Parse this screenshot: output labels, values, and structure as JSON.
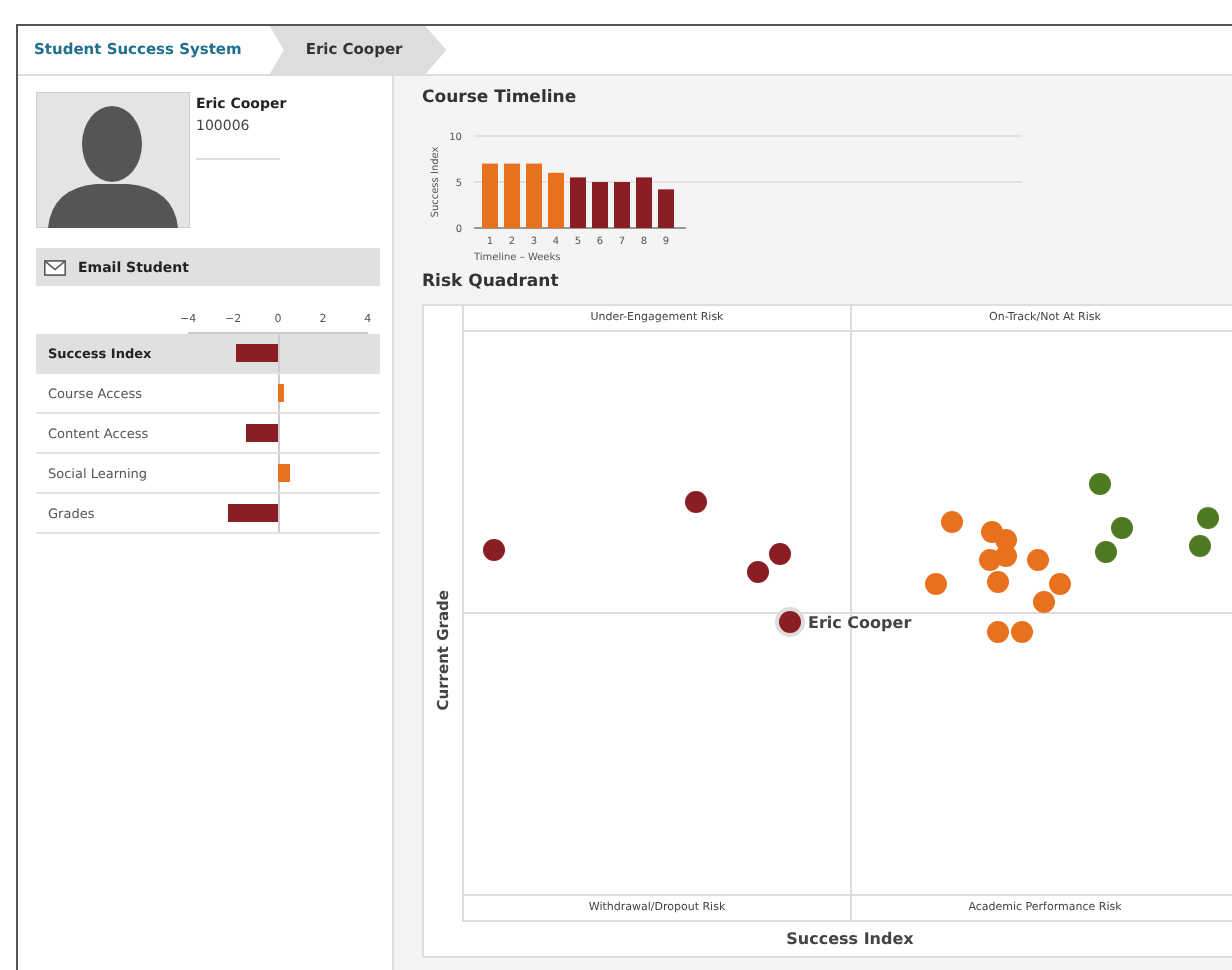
{
  "breadcrumbs": [
    {
      "label": "Student Success System",
      "selected": false
    },
    {
      "label": "Eric Cooper",
      "selected": true
    }
  ],
  "student": {
    "name": "Eric Cooper",
    "id": "100006"
  },
  "email_button": "Email Student",
  "factors": {
    "rows": [
      {
        "selected": true
      },
      {
        "selected": false
      },
      {
        "selected": false
      },
      {
        "selected": false
      },
      {
        "selected": false
      }
    ],
    "chart_data": {
      "type": "bar",
      "orientation": "horizontal",
      "categories": [
        "Success Index",
        "Course Access",
        "Content Access",
        "Social Learning",
        "Grades"
      ],
      "series": [
        {
          "color": "#8b1e24",
          "values": [
            -1.9,
            null,
            -1.4,
            null,
            -2.2
          ]
        },
        {
          "color": "#e8711e",
          "values": [
            null,
            0.3,
            null,
            0.5,
            null
          ]
        }
      ],
      "xlim": [
        -4,
        4
      ],
      "xticks": [
        {
          "value": -4,
          "label": "−4"
        },
        {
          "value": -2,
          "label": "−2"
        },
        0,
        2,
        4
      ]
    }
  },
  "timeline": {
    "title": "Course Timeline",
    "chart_data": {
      "type": "bar",
      "ylabel": "Success Index",
      "xlabel": "Timeline – Weeks",
      "categories": [
        "1",
        "2",
        "3",
        "4",
        "5",
        "6",
        "7",
        "8",
        "9"
      ],
      "stacked": true,
      "series": [
        {
          "color": "#e8711e",
          "values": [
            7,
            7,
            7,
            6,
            null,
            null,
            null,
            null,
            null
          ]
        },
        {
          "color": "#8b1e24",
          "values": [
            null,
            null,
            null,
            null,
            5.5,
            5,
            5,
            5.5,
            4.2
          ]
        }
      ],
      "ylim": [
        0,
        10
      ],
      "yticks": [
        0,
        5,
        10
      ]
    }
  },
  "quadrant": {
    "title": "Risk Quadrant",
    "top_labels": [
      "Under-Engagement Risk",
      "On-Track/Not At Risk"
    ],
    "bottom_labels": [
      "Withdrawal/Dropout Risk",
      "Academic Performance Risk"
    ],
    "ylabel": "Current Grade",
    "xlabel": "Success Index",
    "highlight_label": "Eric Cooper"
  }
}
